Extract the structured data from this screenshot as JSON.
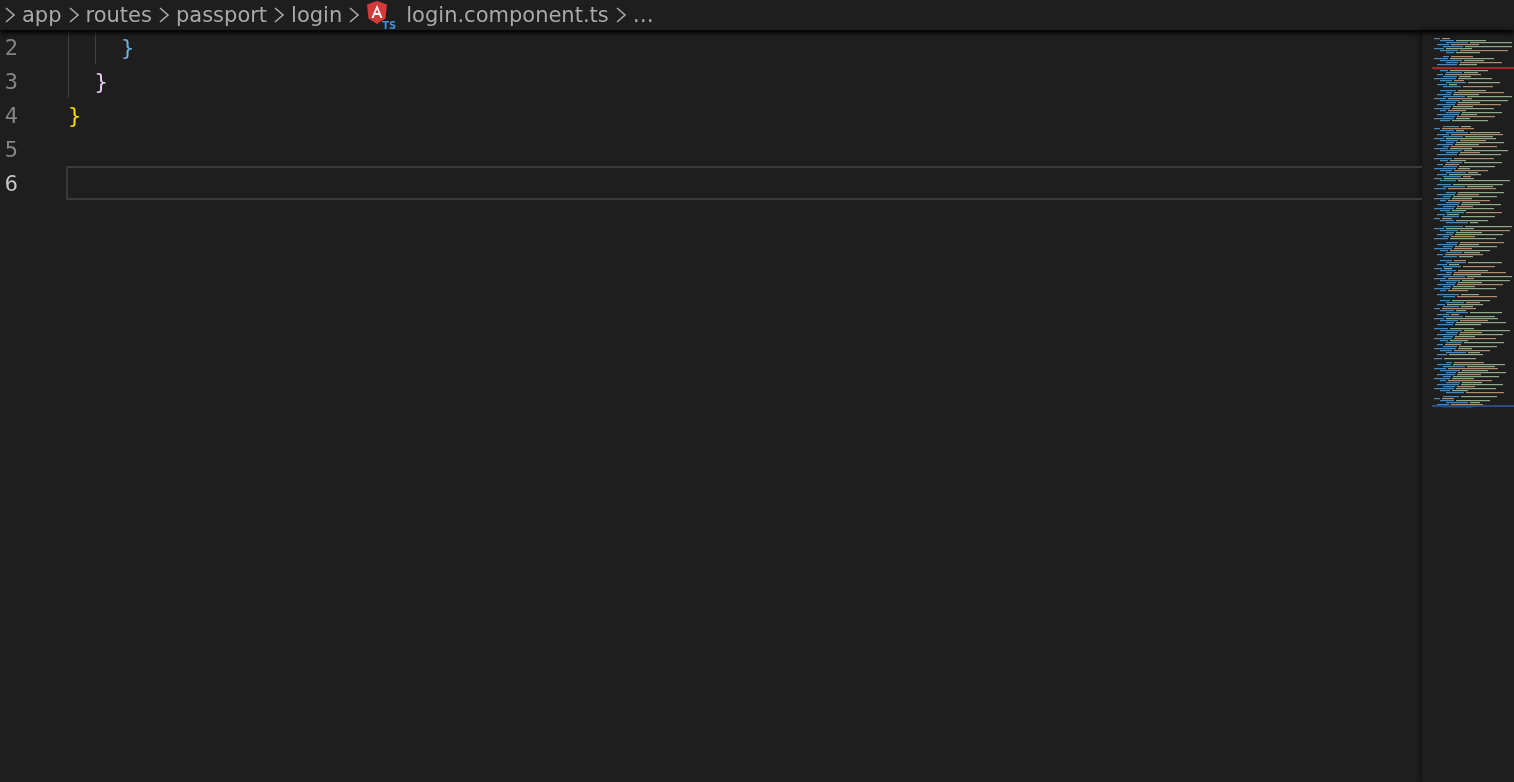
{
  "breadcrumbs": {
    "items": [
      {
        "label": "app",
        "kind": "folder"
      },
      {
        "label": "routes",
        "kind": "folder"
      },
      {
        "label": "passport",
        "kind": "folder"
      },
      {
        "label": "login",
        "kind": "folder"
      },
      {
        "label": "login.component.ts",
        "kind": "file",
        "badge": "TS"
      }
    ],
    "more": "…"
  },
  "editor": {
    "lines": [
      {
        "number": "2",
        "text": "    }",
        "color": "#6cb0e0",
        "selected": false
      },
      {
        "number": "3",
        "text": "  }",
        "color": "#e8c8f0",
        "selected": false
      },
      {
        "number": "4",
        "text": "}",
        "color": "#ffd700",
        "selected": false
      },
      {
        "number": "5",
        "selected": false
      },
      {
        "number": "6",
        "selected": true
      }
    ]
  }
}
